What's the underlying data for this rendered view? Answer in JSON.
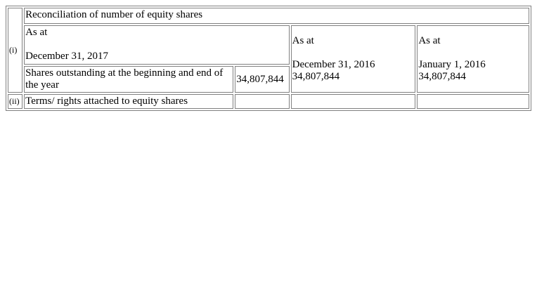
{
  "section_i": {
    "label": "(i)",
    "title": "Reconciliation of number of equity shares",
    "col1": {
      "as_at": "As at",
      "date": "December 31, 2017"
    },
    "col2": {
      "as_at": "As at",
      "date": "December 31, 2016",
      "value": "34,807,844"
    },
    "col3": {
      "as_at": "As at",
      "date": "January 1, 2016",
      "value": "34,807,844"
    },
    "row_label": "Shares outstanding at the beginning and end of the year",
    "row_value_2017": "34,807,844"
  },
  "section_ii": {
    "label": "(ii)",
    "title": "Terms/ rights attached to equity shares"
  }
}
